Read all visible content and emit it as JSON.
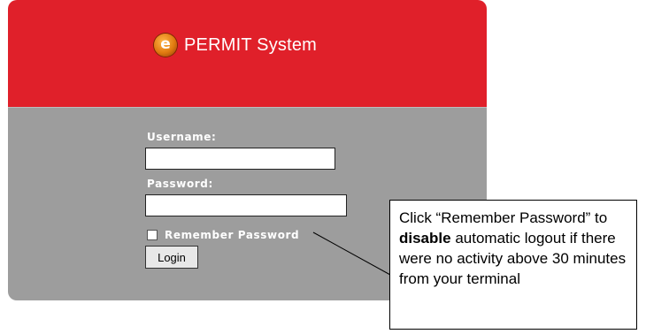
{
  "header": {
    "title": "PERMIT System",
    "logo_icon": "e-logo-icon",
    "background": "#e0202a"
  },
  "form": {
    "username_label": "Username:",
    "username_value": "",
    "password_label": "Password:",
    "password_value": "",
    "remember_label": "Remember Password",
    "remember_checked": false,
    "login_label": "Login",
    "panel_color": "#9d9d9d"
  },
  "callout": {
    "text_before": "Click “Remember Password” to ",
    "bold": "disable",
    "text_after": " automatic logout if there were no activity above 30 minutes from your terminal"
  }
}
